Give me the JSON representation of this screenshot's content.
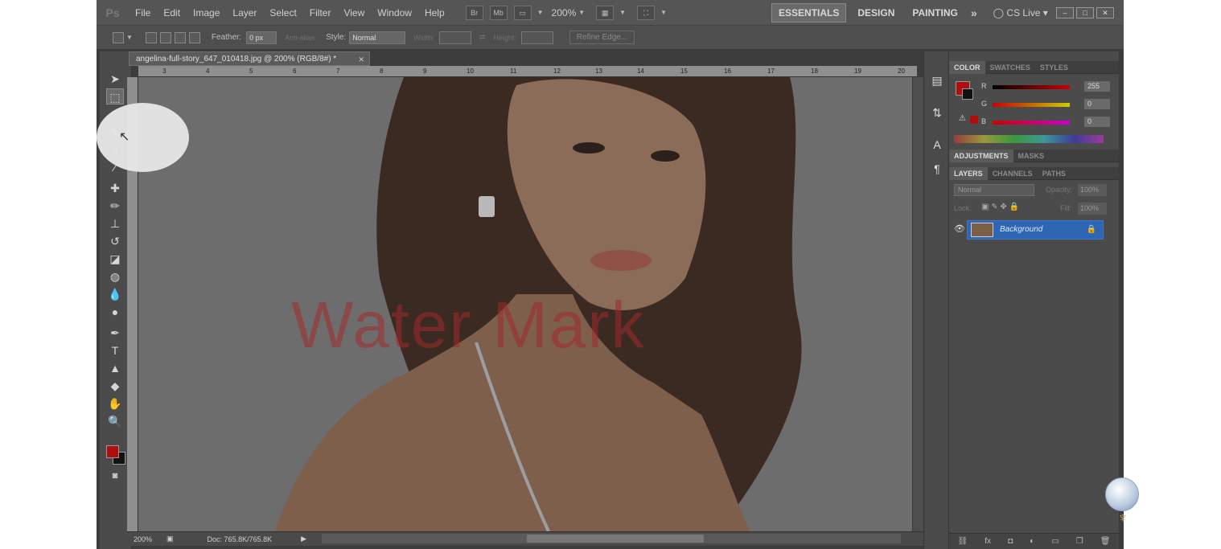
{
  "app": {
    "logo": "Ps",
    "menus": [
      "File",
      "Edit",
      "Image",
      "Layer",
      "Select",
      "Filter",
      "View",
      "Window",
      "Help"
    ],
    "toolbar_icons": [
      "Br",
      "Mb"
    ],
    "zoom": "200%",
    "workspaces": [
      "ESSENTIALS",
      "DESIGN",
      "PAINTING"
    ],
    "active_workspace": "ESSENTIALS",
    "cslive": "CS Live",
    "window_buttons": [
      "–",
      "□",
      "✕"
    ]
  },
  "options": {
    "feather_label": "Feather:",
    "feather_value": "0 px",
    "antialias_label": "Anti-alias",
    "style_label": "Style:",
    "style_value": "Normal",
    "width_label": "Width:",
    "height_label": "Height:",
    "refine_edge": "Refine Edge..."
  },
  "document": {
    "tab_title": "angelina-full-story_647_010418.jpg @ 200% (RGB/8#) *",
    "ruler_ticks": [
      "3",
      "4",
      "5",
      "6",
      "7",
      "8",
      "9",
      "10",
      "11",
      "12",
      "13",
      "14",
      "15",
      "16",
      "17",
      "18",
      "19",
      "20"
    ],
    "watermark": "Water Mark",
    "status_zoom": "200%",
    "status_doc": "Doc: 765.8K/765.8K"
  },
  "panels": {
    "color_tabs": [
      "COLOR",
      "SWATCHES",
      "STYLES"
    ],
    "sliders": [
      {
        "letter": "R",
        "value": "255"
      },
      {
        "letter": "G",
        "value": "0"
      },
      {
        "letter": "B",
        "value": "0"
      }
    ],
    "adjust_tabs": [
      "ADJUSTMENTS",
      "MASKS"
    ],
    "layer_tabs": [
      "LAYERS",
      "CHANNELS",
      "PATHS"
    ],
    "blend_mode": "Normal",
    "opacity_label": "Opacity:",
    "opacity_value": "100%",
    "lock_label": "Lock:",
    "fill_label": "Fill:",
    "fill_value": "100%",
    "layer_name": "Background"
  },
  "colors": {
    "foreground": "#b00d0d",
    "background": "#111111",
    "selected_layer": "#2f66b4"
  }
}
